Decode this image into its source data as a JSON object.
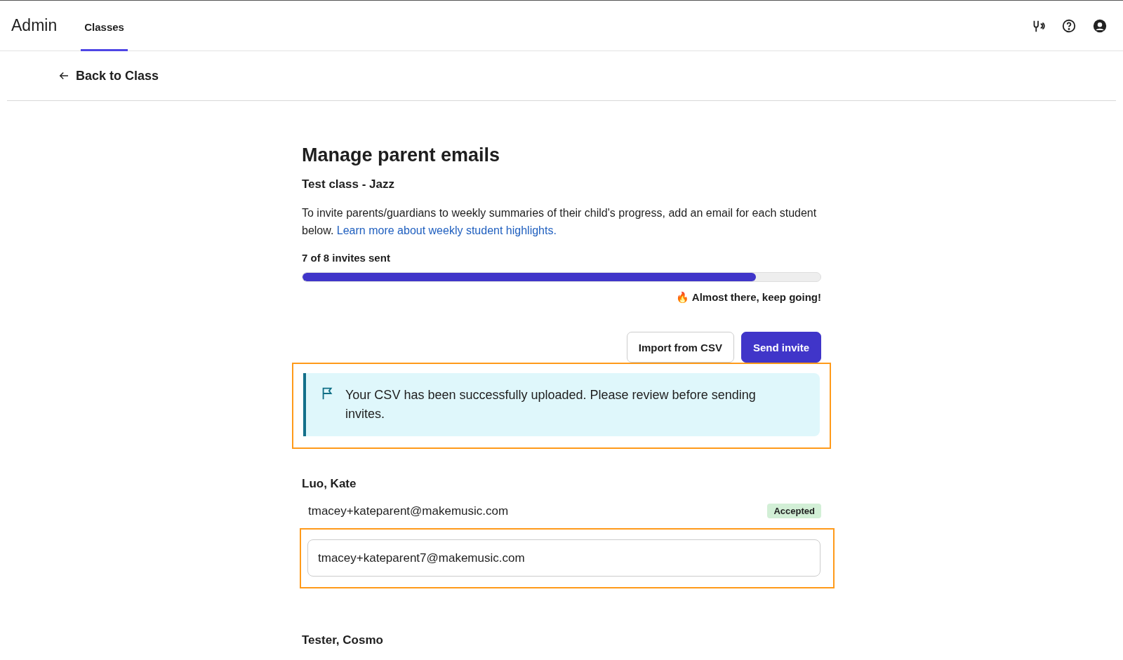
{
  "topbar": {
    "title": "Admin",
    "tabs": [
      {
        "label": "Classes",
        "selected": true
      }
    ]
  },
  "back_link": "Back to Class",
  "page": {
    "title": "Manage parent emails",
    "subtitle": "Test class - Jazz",
    "intro": "To invite parents/guardians to weekly summaries of their child's progress, add an email for each student below.",
    "intro_link": "Learn more about weekly student highlights.",
    "progress": {
      "label": "7 of 8 invites sent",
      "level": 0.875,
      "message": "🔥 Almost there, keep going!"
    },
    "buttons": [
      {
        "label": "Import from CSV",
        "kind": "secondary"
      },
      {
        "label": "Send invite",
        "kind": "primary"
      }
    ],
    "alert": {
      "text": "Your CSV has been successfully uploaded. Please review before sending invites.",
      "highlighted": true
    },
    "students": [
      {
        "name": "Luo, Kate",
        "email": "tmacey+kateparent@makemusic.com",
        "status": "Accepted",
        "input_value": "tmacey+kateparent7@makemusic.com",
        "highlighted": true
      },
      {
        "name": "Tester, Cosmo"
      }
    ]
  }
}
